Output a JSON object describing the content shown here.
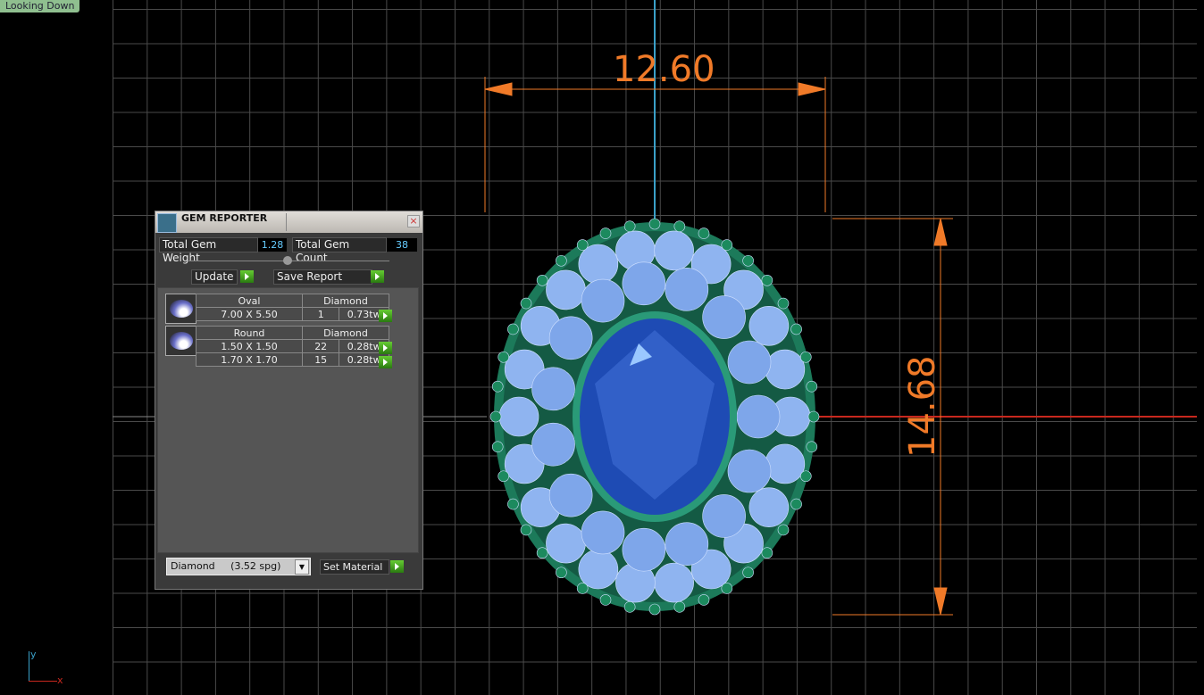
{
  "viewport": {
    "label": "Looking Down",
    "axis_y": "y",
    "axis_x": "x"
  },
  "dimensions": {
    "width": "12.60",
    "height": "14.68"
  },
  "colors": {
    "dimension": "#f07a28",
    "axis_y": "#3aa0c8",
    "axis_x": "#c8281e",
    "gem_blue": "#1e4bb4",
    "setting_green": "#1c7a5a"
  },
  "dialog": {
    "title": "GEM REPORTER",
    "total_weight_label": "Total Gem Weight",
    "total_weight": "1.28",
    "total_count_label": "Total Gem Count",
    "total_count": "38",
    "update_label": "Update",
    "save_label": "Save Report",
    "groups": [
      {
        "shape": "Oval",
        "material": "Diamond",
        "rows": [
          {
            "size": "7.00 X 5.50",
            "count": "1",
            "weight": "0.73tw"
          }
        ]
      },
      {
        "shape": "Round",
        "material": "Diamond",
        "rows": [
          {
            "size": "1.50 X 1.50",
            "count": "22",
            "weight": "0.28tw"
          },
          {
            "size": "1.70 X 1.70",
            "count": "15",
            "weight": "0.28tw"
          }
        ]
      }
    ],
    "material_select": "Diamond     (3.52 spg)",
    "set_material_label": "Set Material"
  }
}
